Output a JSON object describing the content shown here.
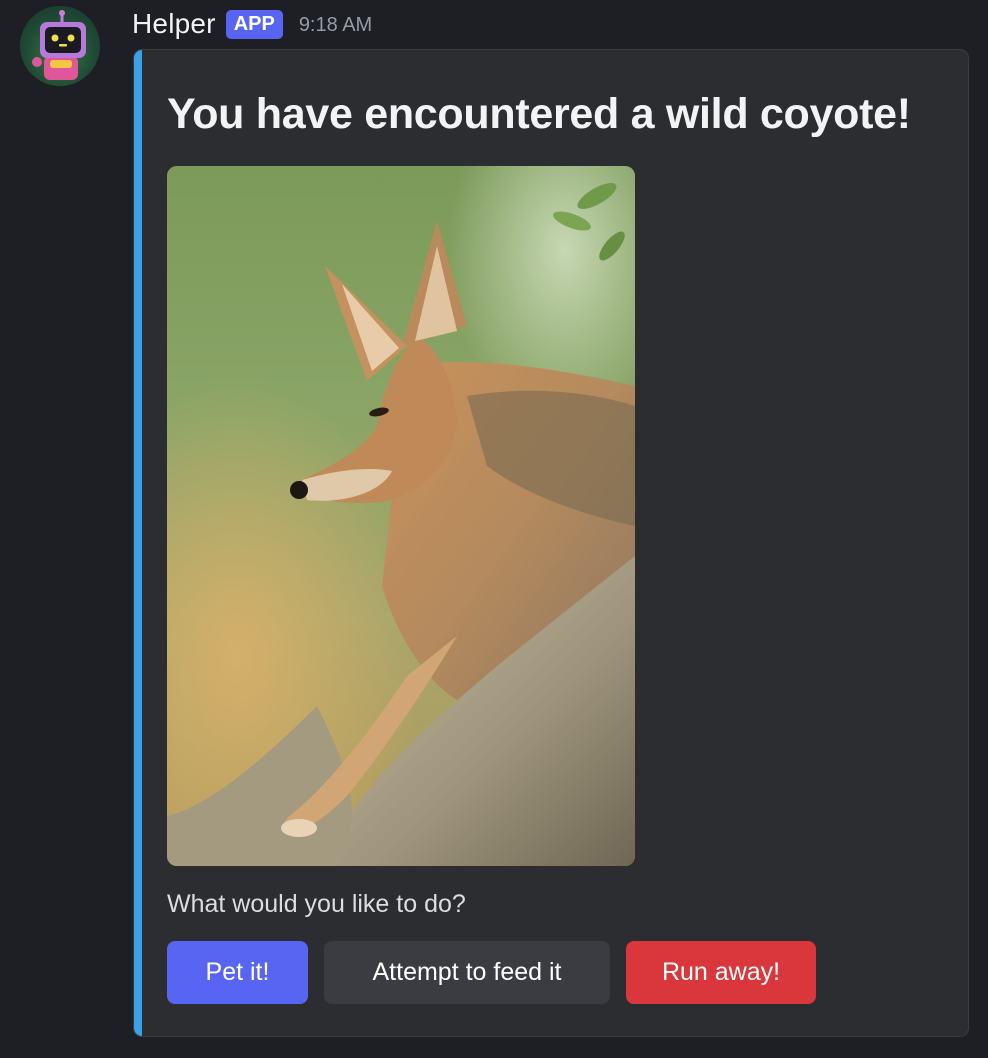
{
  "message": {
    "author": "Helper",
    "badge": "APP",
    "timestamp": "9:18 AM",
    "avatar_icon": "robot-avatar-icon"
  },
  "embed": {
    "accent_color": "#3aa0e8",
    "title": "You have encountered a wild coyote!",
    "image_subject": "coyote-photo",
    "description": "What would you like to do?"
  },
  "buttons": {
    "pet": {
      "label": "Pet it!",
      "color": "#5865f2"
    },
    "feed": {
      "label": "Attempt to feed it",
      "color": "#3a3c42"
    },
    "run": {
      "label": "Run away!",
      "color": "#da373c"
    }
  }
}
